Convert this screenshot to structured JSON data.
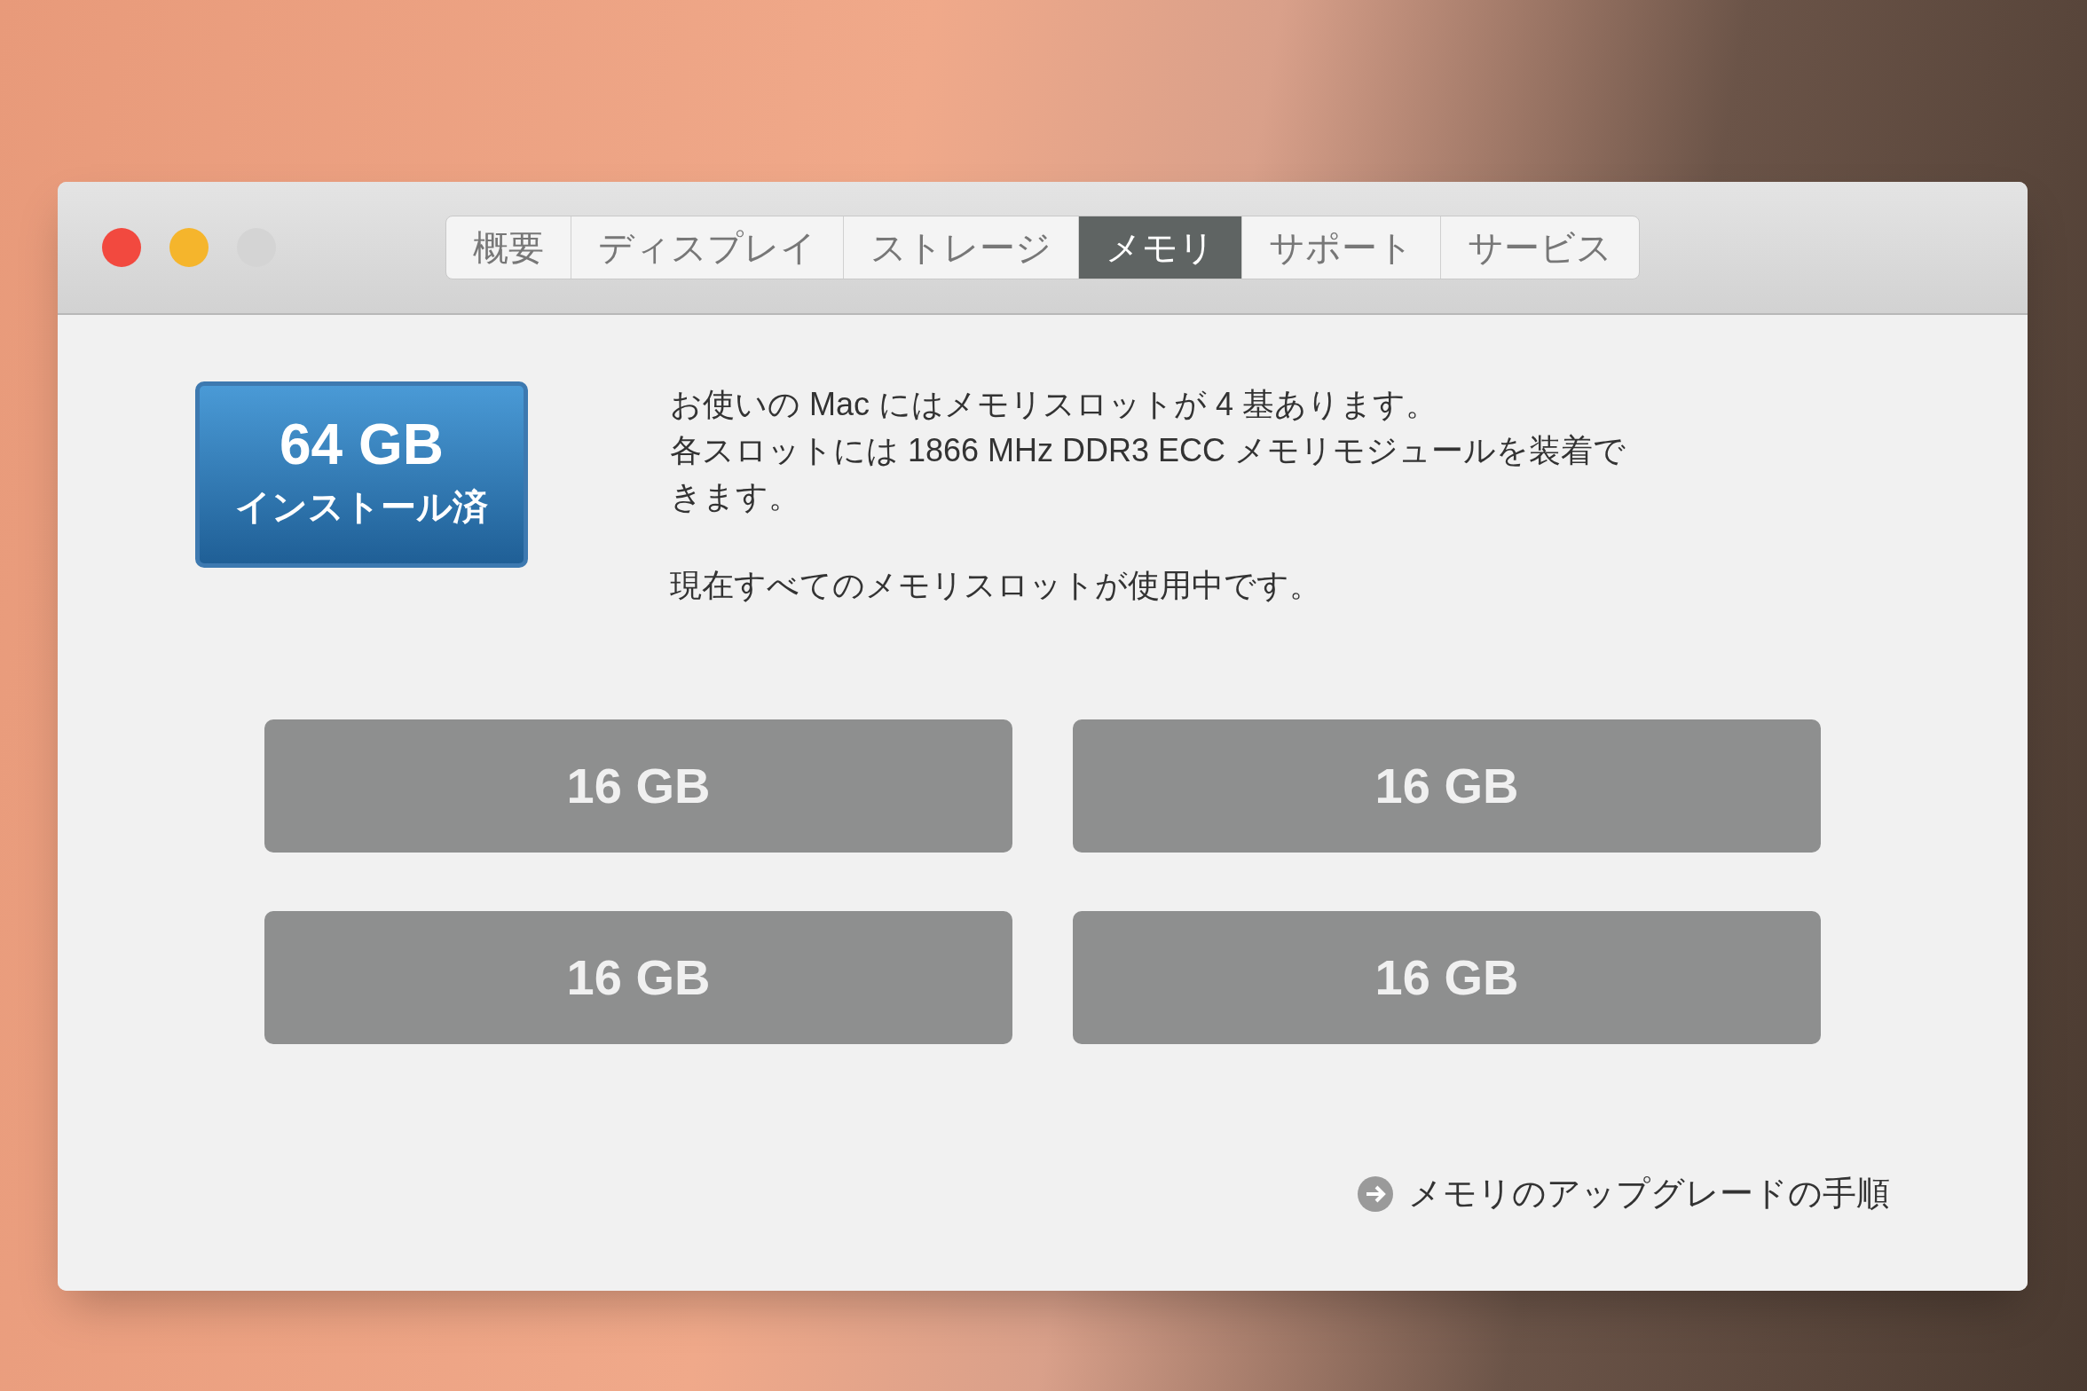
{
  "window": {
    "traffic_lights": [
      {
        "color": "#f2493f"
      },
      {
        "color": "#f5b52c"
      },
      {
        "color": "#d4d4d4"
      }
    ]
  },
  "tabs": [
    {
      "label": "概要",
      "selected": false
    },
    {
      "label": "ディスプレイ",
      "selected": false
    },
    {
      "label": "ストレージ",
      "selected": false
    },
    {
      "label": "メモリ",
      "selected": true
    },
    {
      "label": "サポート",
      "selected": false
    },
    {
      "label": "サービス",
      "selected": false
    }
  ],
  "memory_badge": {
    "size": "64 GB",
    "label": "インストール済"
  },
  "description": [
    "お使いの Mac にはメモリスロットが 4 基あります。",
    "各スロットには 1866 MHz DDR3 ECC メモリモジュールを装着できます。",
    "現在すべてのメモリスロットが使用中です。"
  ],
  "slots": [
    "16 GB",
    "16 GB",
    "16 GB",
    "16 GB"
  ],
  "upgrade_link": "メモリのアップグレードの手順"
}
